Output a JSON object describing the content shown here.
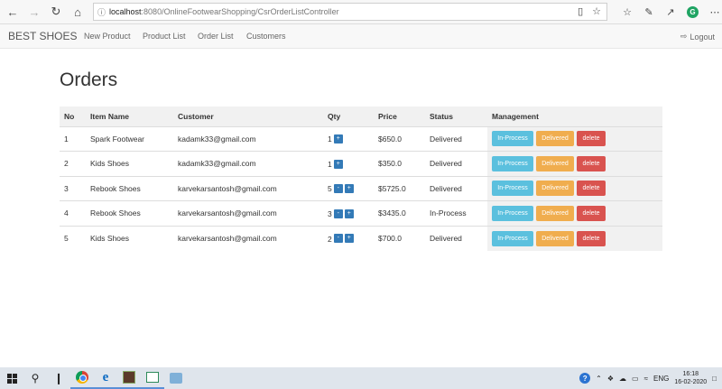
{
  "browser": {
    "url_host": "localhost",
    "url_path": ":8080/OnlineFootwearShopping/CsrOrderListController"
  },
  "navbar": {
    "brand": "BEST SHOES",
    "links": [
      "New Product",
      "Product List",
      "Order List",
      "Customers"
    ],
    "logout": "Logout"
  },
  "page": {
    "title": "Orders"
  },
  "table": {
    "headers": [
      "No",
      "Item Name",
      "Customer",
      "Qty",
      "Price",
      "Status",
      "Management"
    ],
    "rows": [
      {
        "no": "1",
        "item": "Spark Footwear",
        "customer": "kadamk33@gmail.com",
        "qty": "1",
        "price": "$650.0",
        "status": "Delivered",
        "show_minus": false
      },
      {
        "no": "2",
        "item": "Kids Shoes",
        "customer": "kadamk33@gmail.com",
        "qty": "1",
        "price": "$350.0",
        "status": "Delivered",
        "show_minus": false
      },
      {
        "no": "3",
        "item": "Rebook Shoes",
        "customer": "karvekarsantosh@gmail.com",
        "qty": "5",
        "price": "$5725.0",
        "status": "Delivered",
        "show_minus": true
      },
      {
        "no": "4",
        "item": "Rebook Shoes",
        "customer": "karvekarsantosh@gmail.com",
        "qty": "3",
        "price": "$3435.0",
        "status": "In-Process",
        "show_minus": true
      },
      {
        "no": "5",
        "item": "Kids Shoes",
        "customer": "karvekarsantosh@gmail.com",
        "qty": "2",
        "price": "$700.0",
        "status": "Delivered",
        "show_minus": true
      }
    ],
    "qty_minus_label": "-",
    "qty_plus_label": "+",
    "btn_inprocess": "In-Process",
    "btn_delivered": "Delivered",
    "btn_delete": "delete"
  },
  "taskbar": {
    "lang": "ENG",
    "time": "16:18",
    "date": "16-02-2020"
  },
  "colors": {
    "inprocess": "#5bc0de",
    "delivered": "#f0ad4e",
    "delete": "#d9534f",
    "qty_button": "#337ab7"
  }
}
